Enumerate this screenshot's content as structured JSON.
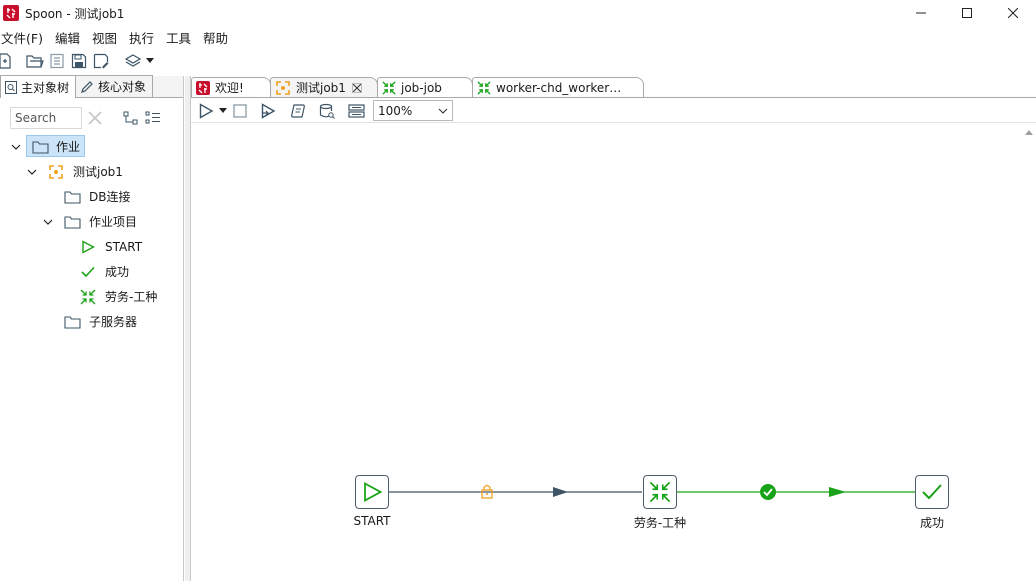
{
  "window": {
    "title": "Spoon - 测试job1"
  },
  "menu": {
    "items": [
      "文件(F)",
      "编辑",
      "视图",
      "执行",
      "工具",
      "帮助"
    ]
  },
  "main_toolbar": {
    "icons": [
      "new-file-icon",
      "open-folder-icon",
      "explore-repository-icon",
      "save-icon",
      "save-as-icon",
      "layers-icon",
      "dropdown-arrow-icon"
    ]
  },
  "left_panel": {
    "tabs": [
      {
        "label": "主对象树",
        "icon": "search-tree-icon",
        "active": true
      },
      {
        "label": "核心对象",
        "icon": "pencil-icon",
        "active": false
      }
    ],
    "search": {
      "placeholder": "Search"
    },
    "tree": [
      {
        "label": "作业",
        "icon": "folder-icon",
        "level": 0,
        "expanded": true,
        "selected": true
      },
      {
        "label": "测试job1",
        "icon": "job-icon",
        "level": 1,
        "expanded": true
      },
      {
        "label": "DB连接",
        "icon": "folder-icon",
        "level": 2
      },
      {
        "label": "作业项目",
        "icon": "folder-icon",
        "level": 2,
        "expanded": true
      },
      {
        "label": "START",
        "icon": "start-icon",
        "level": 3
      },
      {
        "label": "成功",
        "icon": "success-check-icon",
        "level": 3
      },
      {
        "label": "劳务-工种",
        "icon": "job-entry-icon",
        "level": 3
      },
      {
        "label": "子服务器",
        "icon": "folder-icon",
        "level": 2
      }
    ]
  },
  "editor_tabs": [
    {
      "label": "欢迎!",
      "icon": "spoon-logo-icon",
      "active": false,
      "closable": false
    },
    {
      "label": "测试job1",
      "icon": "job-icon",
      "active": true,
      "closable": true
    },
    {
      "label": "job-job",
      "icon": "job-entry-icon",
      "active": false,
      "closable": false
    },
    {
      "label": "worker-chd_worker…",
      "icon": "job-entry-icon",
      "active": false,
      "closable": false
    }
  ],
  "editor_toolbar": {
    "zoom": "100%"
  },
  "canvas": {
    "nodes": [
      {
        "label": "START",
        "icon": "start-icon"
      },
      {
        "label": "劳务-工种",
        "icon": "job-entry-icon"
      },
      {
        "label": "成功",
        "icon": "success-check-icon"
      }
    ],
    "hops": [
      {
        "from": "START",
        "to": "劳务-工种",
        "status": "unconditional",
        "icon": "lock-icon",
        "color": "#3d5566"
      },
      {
        "from": "劳务-工种",
        "to": "成功",
        "status": "success",
        "icon": "check-circle-icon",
        "color": "#19a319"
      }
    ]
  },
  "colors": {
    "accent_selection": "#cce4f7",
    "logo_red": "#c8102e",
    "success_green": "#19a319",
    "hop_dark": "#3d5566",
    "lock_orange": "#f0a020"
  }
}
